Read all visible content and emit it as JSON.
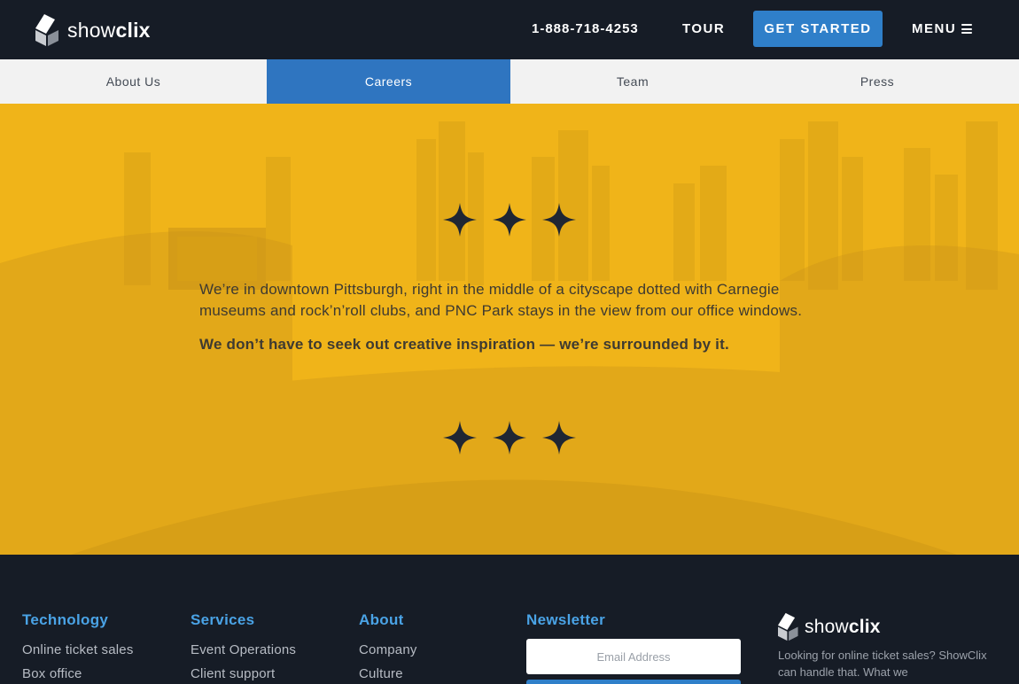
{
  "header": {
    "logo_word_light": "show",
    "logo_word_bold": "clix",
    "phone": "1-888-718-4253",
    "tour_label": "TOUR",
    "get_started_label": "GET STARTED",
    "menu_label": "MENU"
  },
  "subnav": {
    "tabs": [
      {
        "label": "About Us",
        "active": false
      },
      {
        "label": "Careers",
        "active": true
      },
      {
        "label": "Team",
        "active": false
      },
      {
        "label": "Press",
        "active": false
      }
    ]
  },
  "hero": {
    "paragraph": "We’re in downtown Pittsburgh, right in the middle of a cityscape dotted with Carnegie museums and rock’n’roll clubs, and PNC Park stays in the view from our office windows.",
    "emphasis": "We don’t have to seek out creative inspiration — we’re surrounded by it.",
    "star_icon": "four-point-star-icon",
    "star_color": "#1f2633",
    "overlay_color": "#f0b419"
  },
  "footer": {
    "columns": [
      {
        "title": "Technology",
        "links": [
          "Online ticket sales",
          "Box office"
        ]
      },
      {
        "title": "Services",
        "links": [
          "Event Operations",
          "Client support"
        ]
      },
      {
        "title": "About",
        "links": [
          "Company",
          "Culture"
        ]
      }
    ],
    "newsletter": {
      "title": "Newsletter",
      "email_placeholder": "Email Address"
    },
    "logo_word_light": "show",
    "logo_word_bold": "clix",
    "description": "Looking for online ticket sales? ShowClix can handle that. What we"
  },
  "colors": {
    "header_bg": "#161c26",
    "accent_blue": "#2f7fc9",
    "footer_heading": "#4aa3e6",
    "subnav_bg": "#f2f2f2"
  }
}
